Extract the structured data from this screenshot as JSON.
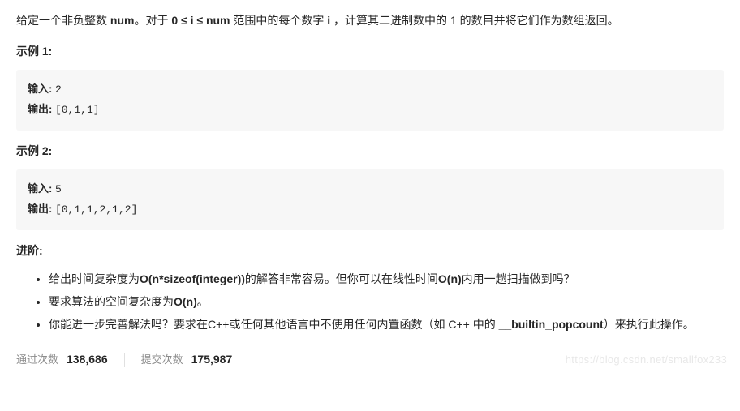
{
  "problem": {
    "desc_pre": "给定一个非负整数 ",
    "desc_var": "num",
    "desc_mid1": "。对于 ",
    "desc_range": "0 ≤ i ≤ num",
    "desc_mid2": " 范围中的每个数字 ",
    "desc_ivar": "i",
    "desc_post": " ，计算其二进制数中的 1 的数目并将它们作为数组返回。"
  },
  "example1": {
    "heading": "示例 1:",
    "input_label": "输入: ",
    "input_val": "2",
    "output_label": "输出: ",
    "output_val": "[0,1,1]"
  },
  "example2": {
    "heading": "示例 2:",
    "input_label": "输入: ",
    "input_val": "5",
    "output_label": "输出: ",
    "output_val": "[0,1,1,2,1,2]"
  },
  "advanced": {
    "heading": "进阶:",
    "item1_pre": "给出时间复杂度为",
    "item1_b1": "O(n*sizeof(integer))",
    "item1_mid": "的解答非常容易。但你可以在线性时间",
    "item1_b2": "O(n)",
    "item1_post": "内用一趟扫描做到吗？",
    "item2_pre": "要求算法的空间复杂度为",
    "item2_b": "O(n)",
    "item2_post": "。",
    "item3_pre": "你能进一步完善解法吗？要求在C++或任何其他语言中不使用任何内置函数（如 C++ 中的 ",
    "item3_b": "__builtin_popcount",
    "item3_post": "）来执行此操作。"
  },
  "stats": {
    "pass_label": "通过次数",
    "pass_val": "138,686",
    "submit_label": "提交次数",
    "submit_val": "175,987"
  },
  "watermark": "https://blog.csdn.net/smallfox233"
}
